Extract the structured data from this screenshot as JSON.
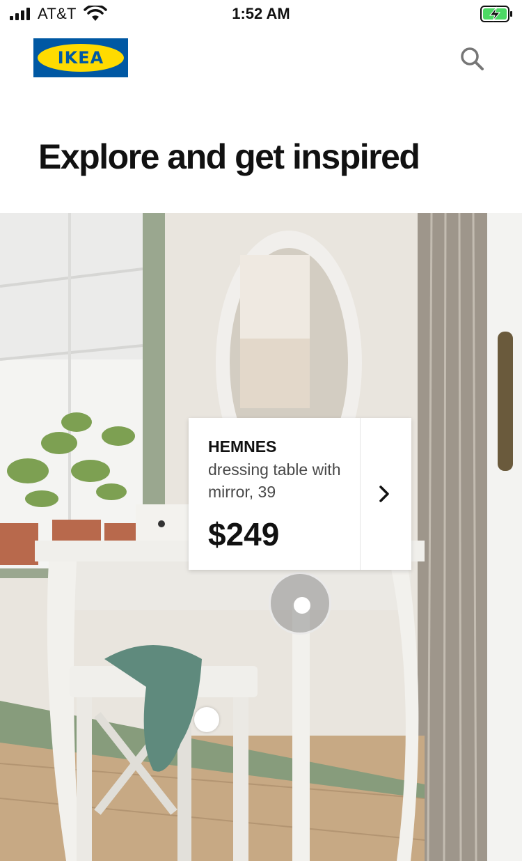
{
  "status_bar": {
    "carrier": "AT&T",
    "time": "1:52 AM"
  },
  "header": {
    "logo_text": "IKEA",
    "search_icon": "search-icon"
  },
  "page": {
    "title": "Explore and get inspired"
  },
  "product_card": {
    "brand": "HEMNES",
    "description": "dressing table with mirror, 39",
    "price": "$249",
    "arrow_icon": "chevron-right-icon"
  },
  "colors": {
    "ikea_blue": "#0058a3",
    "ikea_yellow": "#ffdb00",
    "battery_green": "#4cd964"
  }
}
